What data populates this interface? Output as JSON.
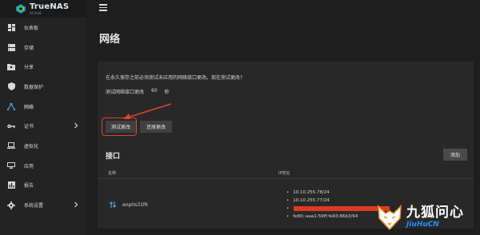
{
  "brand": {
    "name": "TrueNAS",
    "edition": "SCALE"
  },
  "sidebar": {
    "items": [
      {
        "label": "仪表板",
        "icon": "dashboard-icon"
      },
      {
        "label": "存储",
        "icon": "storage-icon"
      },
      {
        "label": "分享",
        "icon": "share-folder-icon"
      },
      {
        "label": "数据保护",
        "icon": "shield-icon"
      },
      {
        "label": "网络",
        "icon": "network-icon",
        "active": true
      },
      {
        "label": "证书",
        "icon": "key-icon",
        "expandable": true
      },
      {
        "label": "虚拟化",
        "icon": "laptop-icon"
      },
      {
        "label": "应用",
        "icon": "apps-icon"
      },
      {
        "label": "报告",
        "icon": "report-icon"
      },
      {
        "label": "系统设置",
        "icon": "gear-icon",
        "expandable": true
      }
    ]
  },
  "page": {
    "title": "网络"
  },
  "test_card": {
    "message": "在永久保存之前必须测试未应用的网络接口更改。现在测试更改?",
    "timeout_label": "测试网络接口更改",
    "timeout_value": "60",
    "timeout_unit": "秒",
    "test_button": "测试更改",
    "revert_button": "还原更改"
  },
  "interfaces": {
    "title": "接口",
    "add_button": "添加",
    "columns": {
      "name": "名称",
      "ip": "IP地址"
    },
    "rows": [
      {
        "name": "enp0s31f6",
        "ips": [
          "10.10.255.78/24",
          "10.10.255.77/24",
          "",
          "fe80::aaa1:59ff:fe93:86b3/64"
        ]
      }
    ]
  },
  "watermark": {
    "cn": "九狐问心",
    "en": "JiuHuCN"
  },
  "colors": {
    "accent": "#e0442a",
    "redaction": "#e03a1e",
    "brand_blue": "#1e8fff"
  }
}
